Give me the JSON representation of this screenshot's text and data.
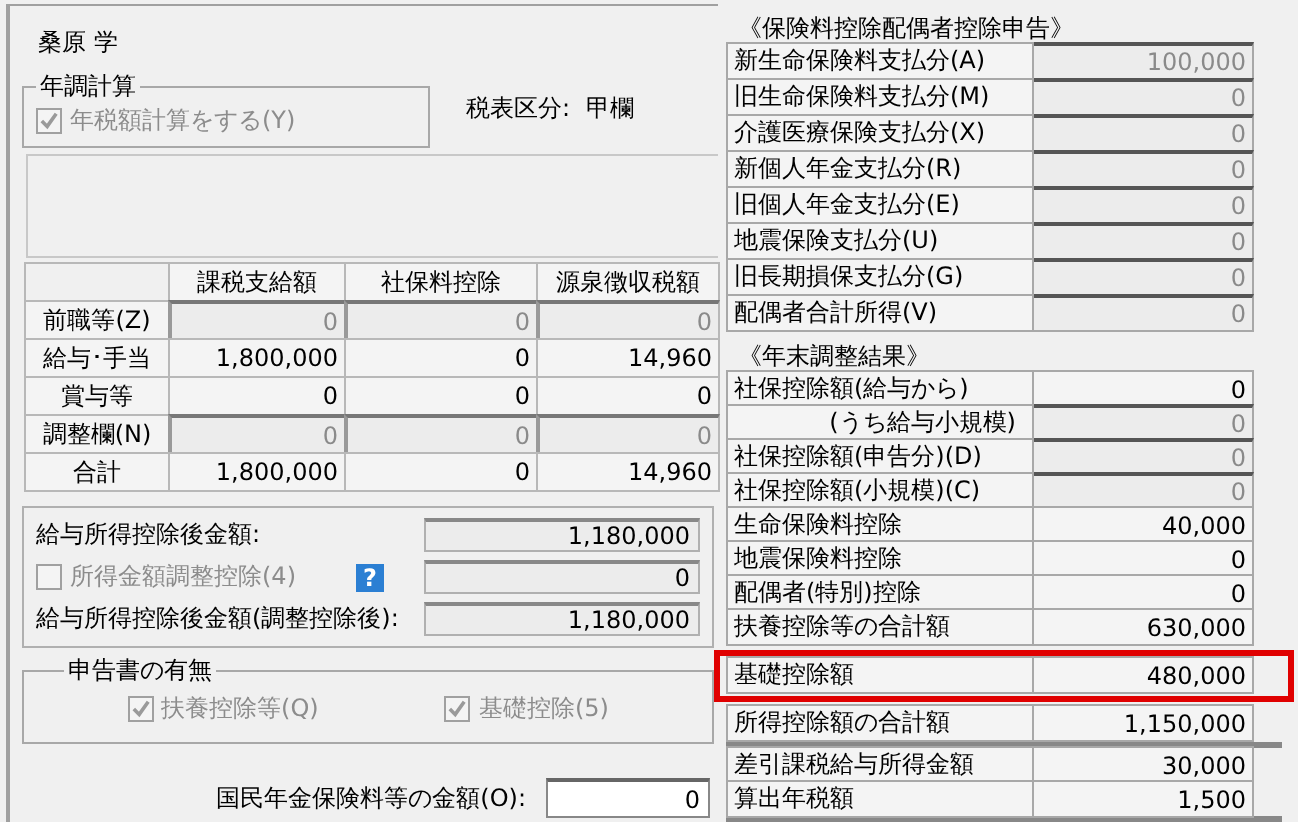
{
  "employee_name": "桑原 学",
  "year_end_calc": {
    "title": "年調計算",
    "checkbox": {
      "label": "年税額計算をする(Y)",
      "checked": true,
      "disabled": true
    }
  },
  "tax_table": {
    "label": "税表区分:",
    "value": "甲欄"
  },
  "income_table": {
    "columns": [
      "課税支給額",
      "社保料控除",
      "源泉徴収税額"
    ],
    "rows": [
      {
        "label": "前職等(Z)",
        "kind": "field",
        "values": [
          "0",
          "0",
          "0"
        ]
      },
      {
        "label": "給与･手当",
        "kind": "plain",
        "values": [
          "1,800,000",
          "0",
          "14,960"
        ]
      },
      {
        "label": "賞与等",
        "kind": "plain",
        "values": [
          "0",
          "0",
          "0"
        ]
      },
      {
        "label": "調整欄(N)",
        "kind": "field",
        "values": [
          "0",
          "0",
          "0"
        ]
      },
      {
        "label": "合計",
        "kind": "plain",
        "values": [
          "1,800,000",
          "0",
          "14,960"
        ]
      }
    ]
  },
  "after_deduction": {
    "rows": [
      {
        "kind": "label",
        "label": "給与所得控除後金額:",
        "value": "1,180,000"
      },
      {
        "kind": "checkbox",
        "label": "所得金額調整控除(4)",
        "checked": false,
        "disabled": true,
        "help": "?",
        "value": "0"
      },
      {
        "kind": "label",
        "label": "給与所得控除後金額(調整控除後):",
        "value": "1,180,000"
      }
    ]
  },
  "declarations": {
    "title": "申告書の有無",
    "checkboxes": [
      {
        "label": "扶養控除等(Q)",
        "checked": true,
        "disabled": true
      },
      {
        "label": "基礎控除(5)",
        "checked": true,
        "disabled": true
      }
    ]
  },
  "pension": {
    "label": "国民年金保険料等の金額(O):",
    "value": "0"
  },
  "insurance_section": {
    "title": "《保険料控除配偶者控除申告》",
    "rows": [
      {
        "label": "新生命保険料支払分(A)",
        "value": "100,000",
        "kind": "field"
      },
      {
        "label": "旧生命保険料支払分(M)",
        "value": "0",
        "kind": "field"
      },
      {
        "label": "介護医療保険支払分(X)",
        "value": "0",
        "kind": "field"
      },
      {
        "label": "新個人年金支払分(R)",
        "value": "0",
        "kind": "field"
      },
      {
        "label": "旧個人年金支払分(E)",
        "value": "0",
        "kind": "field"
      },
      {
        "label": "地震保険支払分(U)",
        "value": "0",
        "kind": "field"
      },
      {
        "label": "旧長期損保支払分(G)",
        "value": "0",
        "kind": "field"
      },
      {
        "label": "配偶者合計所得(V)",
        "value": "0",
        "kind": "field"
      }
    ]
  },
  "result_section": {
    "title": "《年末調整結果》",
    "rows": [
      {
        "label": "社保控除額(給与から)",
        "value": "0",
        "kind": "plain",
        "highlighted": false
      },
      {
        "label": "(うち給与小規模)",
        "value": "0",
        "kind": "sub-field",
        "highlighted": false
      },
      {
        "label": "社保控除額(申告分)(D)",
        "value": "0",
        "kind": "field",
        "highlighted": false
      },
      {
        "label": "社保控除額(小規模)(C)",
        "value": "0",
        "kind": "field",
        "highlighted": false
      },
      {
        "label": "生命保険料控除",
        "value": "40,000",
        "kind": "plain",
        "highlighted": false
      },
      {
        "label": "地震保険料控除",
        "value": "0",
        "kind": "plain",
        "highlighted": false
      },
      {
        "label": "配偶者(特別)控除",
        "value": "0",
        "kind": "plain",
        "highlighted": false
      },
      {
        "label": "扶養控除等の合計額",
        "value": "630,000",
        "kind": "plain",
        "highlighted": false
      },
      {
        "label": "基礎控除額",
        "value": "480,000",
        "kind": "plain",
        "highlighted": true
      },
      {
        "label": "所得控除額の合計額",
        "value": "1,150,000",
        "kind": "plain",
        "highlighted": false
      }
    ],
    "final_rows": [
      {
        "label": "差引課税給与所得金額",
        "value": "30,000"
      },
      {
        "label": "算出年税額",
        "value": "1,500"
      }
    ]
  }
}
